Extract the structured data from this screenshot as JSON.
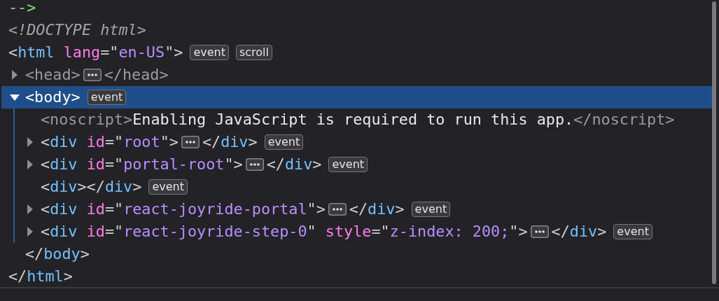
{
  "tree": [
    {
      "selected": false,
      "segments": [
        {
          "kind": "code",
          "tokens": [
            {
              "kind": "comment",
              "s": "-->"
            }
          ]
        }
      ]
    },
    {
      "selected": false,
      "segments": [
        {
          "kind": "code",
          "tokens": [
            {
              "kind": "doctype",
              "s": "<!DOCTYPE html>"
            }
          ]
        }
      ]
    },
    {
      "selected": false,
      "segments": [
        {
          "kind": "code",
          "tokens": [
            {
              "kind": "punct",
              "s": "<"
            },
            {
              "kind": "tag",
              "s": "html "
            },
            {
              "kind": "attr",
              "s": "lang"
            },
            {
              "kind": "punct",
              "s": "=\""
            },
            {
              "kind": "value",
              "s": "en-US"
            },
            {
              "kind": "punct",
              "s": "\">"
            }
          ]
        },
        {
          "kind": "badge",
          "text": "event"
        },
        {
          "kind": "badge",
          "text": "scroll"
        }
      ],
      "children": [
        {
          "expanded": false,
          "selected": false,
          "segments": [
            {
              "kind": "code",
              "tokens": [
                {
                  "kind": "dim",
                  "s": "<head>"
                }
              ]
            },
            {
              "kind": "ellipsis"
            },
            {
              "kind": "code",
              "tokens": [
                {
                  "kind": "dim",
                  "s": "</head>"
                }
              ]
            }
          ]
        },
        {
          "expanded": true,
          "selected": true,
          "segments": [
            {
              "kind": "code",
              "tokens": [
                {
                  "kind": "punct",
                  "s": "<body>"
                }
              ]
            },
            {
              "kind": "badge",
              "text": "event"
            }
          ],
          "children": [
            {
              "selected": false,
              "segments": [
                {
                  "kind": "code",
                  "tokens": [
                    {
                      "kind": "dim",
                      "s": "<noscript>"
                    },
                    {
                      "kind": "text",
                      "s": "Enabling JavaScript is required to run this app."
                    },
                    {
                      "kind": "dim",
                      "s": "</noscript>"
                    }
                  ]
                }
              ]
            },
            {
              "expanded": false,
              "selected": false,
              "segments": [
                {
                  "kind": "code",
                  "tokens": [
                    {
                      "kind": "punct",
                      "s": "<"
                    },
                    {
                      "kind": "tag",
                      "s": "div "
                    },
                    {
                      "kind": "attr",
                      "s": "id"
                    },
                    {
                      "kind": "punct",
                      "s": "=\""
                    },
                    {
                      "kind": "value",
                      "s": "root"
                    },
                    {
                      "kind": "punct",
                      "s": "\">"
                    }
                  ]
                },
                {
                  "kind": "ellipsis"
                },
                {
                  "kind": "code",
                  "tokens": [
                    {
                      "kind": "punct",
                      "s": "</"
                    },
                    {
                      "kind": "tag",
                      "s": "div"
                    },
                    {
                      "kind": "punct",
                      "s": ">"
                    }
                  ]
                },
                {
                  "kind": "badge",
                  "text": "event"
                }
              ]
            },
            {
              "expanded": false,
              "selected": false,
              "segments": [
                {
                  "kind": "code",
                  "tokens": [
                    {
                      "kind": "punct",
                      "s": "<"
                    },
                    {
                      "kind": "tag",
                      "s": "div "
                    },
                    {
                      "kind": "attr",
                      "s": "id"
                    },
                    {
                      "kind": "punct",
                      "s": "=\""
                    },
                    {
                      "kind": "value",
                      "s": "portal-root"
                    },
                    {
                      "kind": "punct",
                      "s": "\">"
                    }
                  ]
                },
                {
                  "kind": "ellipsis"
                },
                {
                  "kind": "code",
                  "tokens": [
                    {
                      "kind": "punct",
                      "s": "</"
                    },
                    {
                      "kind": "tag",
                      "s": "div"
                    },
                    {
                      "kind": "punct",
                      "s": ">"
                    }
                  ]
                },
                {
                  "kind": "badge",
                  "text": "event"
                }
              ]
            },
            {
              "selected": false,
              "segments": [
                {
                  "kind": "code",
                  "tokens": [
                    {
                      "kind": "punct",
                      "s": "<"
                    },
                    {
                      "kind": "tag",
                      "s": "div"
                    },
                    {
                      "kind": "punct",
                      "s": "></"
                    },
                    {
                      "kind": "tag",
                      "s": "div"
                    },
                    {
                      "kind": "punct",
                      "s": ">"
                    }
                  ]
                },
                {
                  "kind": "badge",
                  "text": "event"
                }
              ]
            },
            {
              "expanded": false,
              "selected": false,
              "segments": [
                {
                  "kind": "code",
                  "tokens": [
                    {
                      "kind": "punct",
                      "s": "<"
                    },
                    {
                      "kind": "tag",
                      "s": "div "
                    },
                    {
                      "kind": "attr",
                      "s": "id"
                    },
                    {
                      "kind": "punct",
                      "s": "=\""
                    },
                    {
                      "kind": "value",
                      "s": "react-joyride-portal"
                    },
                    {
                      "kind": "punct",
                      "s": "\">"
                    }
                  ]
                },
                {
                  "kind": "ellipsis"
                },
                {
                  "kind": "code",
                  "tokens": [
                    {
                      "kind": "punct",
                      "s": "</"
                    },
                    {
                      "kind": "tag",
                      "s": "div"
                    },
                    {
                      "kind": "punct",
                      "s": ">"
                    }
                  ]
                },
                {
                  "kind": "badge",
                  "text": "event"
                }
              ]
            },
            {
              "expanded": false,
              "selected": false,
              "segments": [
                {
                  "kind": "code",
                  "tokens": [
                    {
                      "kind": "punct",
                      "s": "<"
                    },
                    {
                      "kind": "tag",
                      "s": "div "
                    },
                    {
                      "kind": "attr",
                      "s": "id"
                    },
                    {
                      "kind": "punct",
                      "s": "=\""
                    },
                    {
                      "kind": "value",
                      "s": "react-joyride-step-0"
                    },
                    {
                      "kind": "punct",
                      "s": "\" "
                    },
                    {
                      "kind": "attr",
                      "s": "style"
                    },
                    {
                      "kind": "punct",
                      "s": "=\""
                    },
                    {
                      "kind": "value",
                      "s": "z-index: 200;"
                    },
                    {
                      "kind": "punct",
                      "s": "\">"
                    }
                  ]
                },
                {
                  "kind": "ellipsis"
                },
                {
                  "kind": "code",
                  "tokens": [
                    {
                      "kind": "punct",
                      "s": "</"
                    },
                    {
                      "kind": "tag",
                      "s": "div"
                    },
                    {
                      "kind": "punct",
                      "s": ">"
                    }
                  ]
                },
                {
                  "kind": "badge",
                  "text": "event"
                }
              ]
            }
          ],
          "closing": [
            {
              "kind": "punct",
              "s": "</"
            },
            {
              "kind": "tag",
              "s": "body"
            },
            {
              "kind": "punct",
              "s": ">"
            }
          ]
        }
      ],
      "closing": [
        {
          "kind": "punct",
          "s": "</"
        },
        {
          "kind": "tag",
          "s": "html"
        },
        {
          "kind": "punct",
          "s": ">"
        }
      ]
    }
  ]
}
